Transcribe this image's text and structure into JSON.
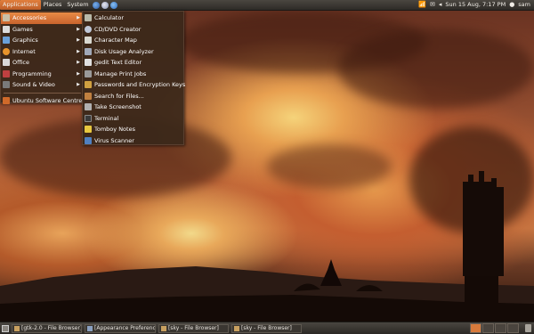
{
  "top_panel": {
    "menus": [
      "Applications",
      "Places",
      "System"
    ],
    "active_menu": "Applications",
    "launchers": [
      "firefox-icon",
      "evolution-icon",
      "help-icon"
    ],
    "clock": "Sun 15 Aug,  7:17 PM",
    "user": "sam"
  },
  "applications_menu": {
    "items": [
      {
        "label": "Accessories",
        "icon": "accessories-icon",
        "color": "#c9c0a8",
        "submenu": true
      },
      {
        "label": "Games",
        "icon": "games-icon",
        "color": "#dcdcdc",
        "submenu": true
      },
      {
        "label": "Graphics",
        "icon": "graphics-icon",
        "color": "#6aa0d8",
        "submenu": true
      },
      {
        "label": "Internet",
        "icon": "internet-icon",
        "color": "#e8942c",
        "submenu": true
      },
      {
        "label": "Office",
        "icon": "office-icon",
        "color": "#d8d8d8",
        "submenu": true
      },
      {
        "label": "Programming",
        "icon": "programming-icon",
        "color": "#c04040",
        "submenu": true
      },
      {
        "label": "Sound & Video",
        "icon": "sound-video-icon",
        "color": "#7a7a7a",
        "submenu": true
      }
    ],
    "footer": {
      "label": "Ubuntu Software Centre",
      "icon": "software-centre-icon",
      "color": "#d06a2a"
    }
  },
  "accessories_menu": {
    "items": [
      {
        "label": "Calculator",
        "icon": "calculator-icon",
        "color": "#b8b8a8"
      },
      {
        "label": "CD/DVD Creator",
        "icon": "cd-dvd-creator-icon",
        "color": "#c0c8d8"
      },
      {
        "label": "Character Map",
        "icon": "character-map-icon",
        "color": "#d8d8d0"
      },
      {
        "label": "Disk Usage Analyzer",
        "icon": "disk-usage-icon",
        "color": "#a0a8b8"
      },
      {
        "label": "gedit Text Editor",
        "icon": "text-editor-icon",
        "color": "#e0e0e0"
      },
      {
        "label": "Manage Print Jobs",
        "icon": "printer-icon",
        "color": "#9a9a9a"
      },
      {
        "label": "Passwords and Encryption Keys",
        "icon": "keys-icon",
        "color": "#d0a040"
      },
      {
        "label": "Search for Files...",
        "icon": "search-icon",
        "color": "#c08040"
      },
      {
        "label": "Take Screenshot",
        "icon": "screenshot-icon",
        "color": "#b0b0b0"
      },
      {
        "label": "Terminal",
        "icon": "terminal-icon",
        "color": "#3a3a3a"
      },
      {
        "label": "Tomboy Notes",
        "icon": "tomboy-icon",
        "color": "#e8c840"
      },
      {
        "label": "Virus Scanner",
        "icon": "virus-scanner-icon",
        "color": "#5080c0"
      }
    ]
  },
  "taskbar": {
    "tasks": [
      {
        "label": "[gtk-2.0 - File Browser]"
      },
      {
        "label": "[Appearance Preferenc...]"
      },
      {
        "label": "[sky - File Browser]"
      },
      {
        "label": "[sky - File Browser]"
      }
    ],
    "workspaces": 4,
    "active_workspace": 1
  }
}
